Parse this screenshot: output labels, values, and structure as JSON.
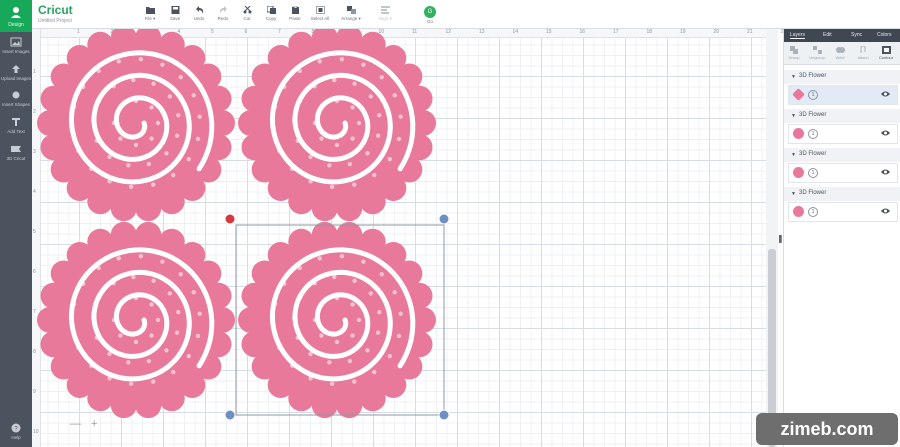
{
  "app": {
    "name": "Cricut",
    "project": "Untitled Project"
  },
  "leftnav": {
    "home": "Design",
    "items": [
      {
        "label": "Insert Images",
        "icon": "images-icon"
      },
      {
        "label": "Upload Images",
        "icon": "upload-icon"
      },
      {
        "label": "Insert Shapes",
        "icon": "shapes-icon"
      },
      {
        "label": "Add Text",
        "icon": "text-icon"
      },
      {
        "label": "3D Cricut",
        "icon": "3d-icon"
      },
      {
        "label": "Help",
        "icon": "help-icon"
      }
    ]
  },
  "toolbar": {
    "items": [
      {
        "label": "File ▾",
        "icon": "file-icon"
      },
      {
        "label": "Save",
        "icon": "save-icon"
      },
      {
        "label": "Undo",
        "icon": "undo-icon"
      },
      {
        "label": "Redo",
        "icon": "redo-icon"
      },
      {
        "label": "Cut",
        "icon": "cut-icon"
      },
      {
        "label": "Copy",
        "icon": "copy-icon"
      },
      {
        "label": "Paste",
        "icon": "paste-icon"
      },
      {
        "label": "Select All",
        "icon": "select-all-icon"
      },
      {
        "label": "Arrange ▾",
        "icon": "arrange-icon"
      },
      {
        "label": "Align ▾",
        "icon": "align-icon"
      }
    ],
    "go": "Go"
  },
  "rulers": {
    "top": [
      "1",
      "2",
      "3",
      "4",
      "5",
      "6",
      "7",
      "8",
      "9",
      "10",
      "11",
      "12",
      "13",
      "14",
      "15",
      "16",
      "17",
      "18",
      "19",
      "20",
      "21",
      "22"
    ],
    "left": [
      "1",
      "2",
      "3",
      "4",
      "5",
      "6",
      "7",
      "8",
      "9",
      "10"
    ]
  },
  "zoom": {
    "minus": "—",
    "plus": "+"
  },
  "panel": {
    "tabs": [
      "Layers",
      "Edit",
      "Sync",
      "Colors"
    ],
    "tools": [
      {
        "label": "Group",
        "icon": "group-icon"
      },
      {
        "label": "Ungroup",
        "icon": "ungroup-icon"
      },
      {
        "label": "Weld",
        "icon": "weld-icon"
      },
      {
        "label": "Attach",
        "icon": "attach-icon"
      },
      {
        "label": "Contour",
        "icon": "contour-icon"
      }
    ],
    "groups": [
      {
        "name": "3D Flower",
        "layer": "1"
      },
      {
        "name": "3D Flower",
        "layer": "1"
      },
      {
        "name": "3D Flower",
        "layer": "1"
      },
      {
        "name": "3D Flower",
        "layer": "1"
      }
    ]
  },
  "colors": {
    "flower": "#e8799a",
    "accent": "#18a85a",
    "nav": "#4b535f"
  },
  "watermark": "zimeb.com"
}
